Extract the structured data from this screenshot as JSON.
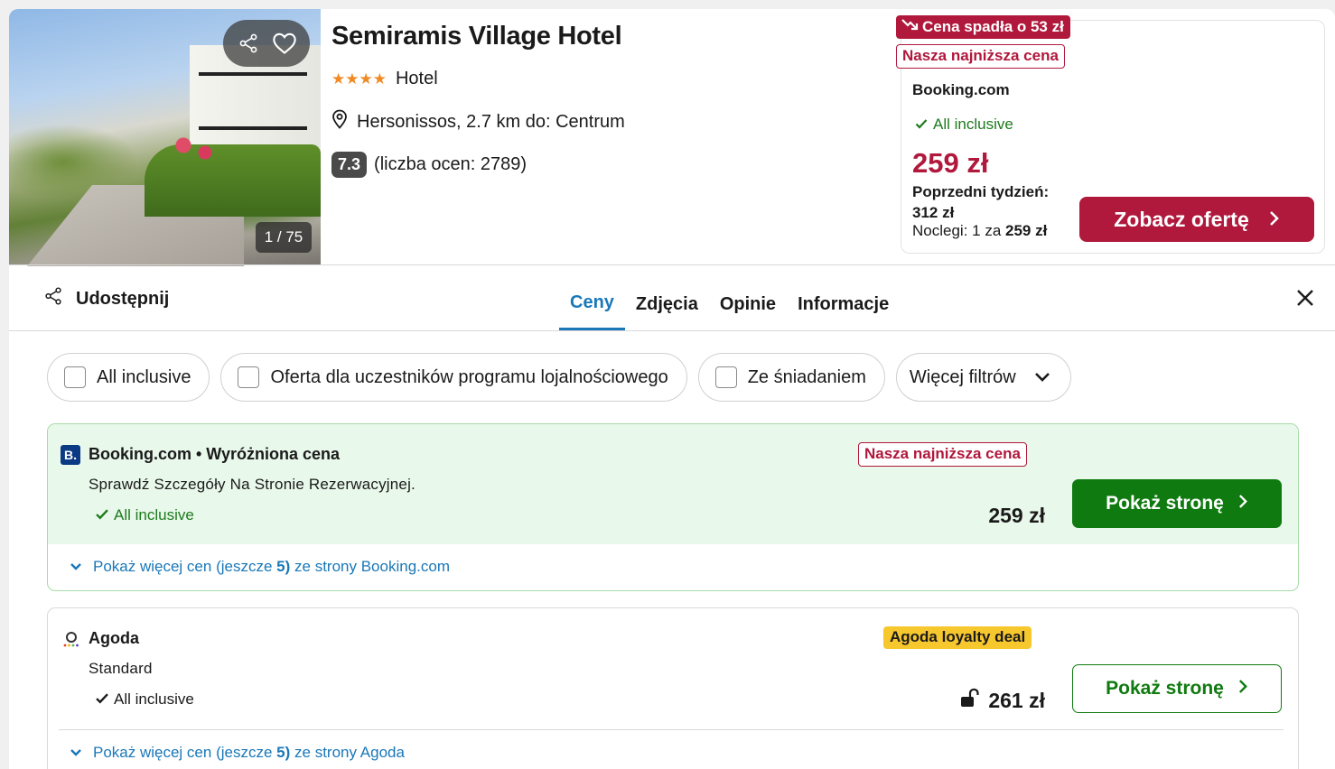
{
  "hotel": {
    "name": "Semiramis Village Hotel",
    "stars": "★★★★",
    "type": "Hotel",
    "location": "Hersonissos, 2.7 km do: Centrum",
    "rating": "7.3",
    "reviews": "(liczba ocen: 2789)",
    "photo_counter": "1 / 75"
  },
  "top_offer": {
    "badge_drop": "Cena spadła o 53 zł",
    "badge_lowest": "Nasza najniższa cena",
    "provider": "Booking.com",
    "inclusion": "All inclusive",
    "price": "259 zł",
    "prev_week_label": "Poprzedni tydzień:",
    "prev_week_price": "312 zł",
    "nights_prefix": "Noclegi: 1 za",
    "nights_price": "259 zł",
    "button": "Zobacz ofertę"
  },
  "toolbar": {
    "share": "Udostępnij",
    "tabs": [
      {
        "label": "Ceny",
        "active": true
      },
      {
        "label": "Zdjęcia",
        "active": false
      },
      {
        "label": "Opinie",
        "active": false
      },
      {
        "label": "Informacje",
        "active": false
      }
    ]
  },
  "filters": [
    {
      "label": "All inclusive",
      "checked": false
    },
    {
      "label": "Oferta dla uczestników programu lojalnościowego",
      "checked": false
    },
    {
      "label": "Ze śniadaniem",
      "checked": false
    },
    {
      "label": "Więcej filtrów"
    }
  ],
  "offers": [
    {
      "logo": "B.",
      "provider_line": "Booking.com • Wyróżniona cena",
      "description": "Sprawdź Szczegóły Na Stronie Rezerwacyjnej.",
      "inclusion": "All inclusive",
      "tag": "Nasza najniższa cena",
      "price": "259 zł",
      "button": "Pokaż stronę",
      "more_prefix": "Pokaż więcej cen (jeszcze",
      "more_count": "5)",
      "more_suffix": "ze strony Booking.com"
    },
    {
      "provider_line": "Agoda",
      "description": "Standard",
      "inclusion": "All inclusive",
      "tag": "Agoda loyalty deal",
      "price": "261 zł",
      "button": "Pokaż stronę",
      "more_prefix": "Pokaż więcej cen (jeszcze",
      "more_count": "5)",
      "more_suffix": "ze strony Agoda"
    }
  ],
  "colors": {
    "brand_red": "#b0183c",
    "link_blue": "#1a78b8",
    "green": "#0f7a0f",
    "highlight_bg": "#e8f8ea",
    "loyalty_yellow": "#f7c72e"
  }
}
